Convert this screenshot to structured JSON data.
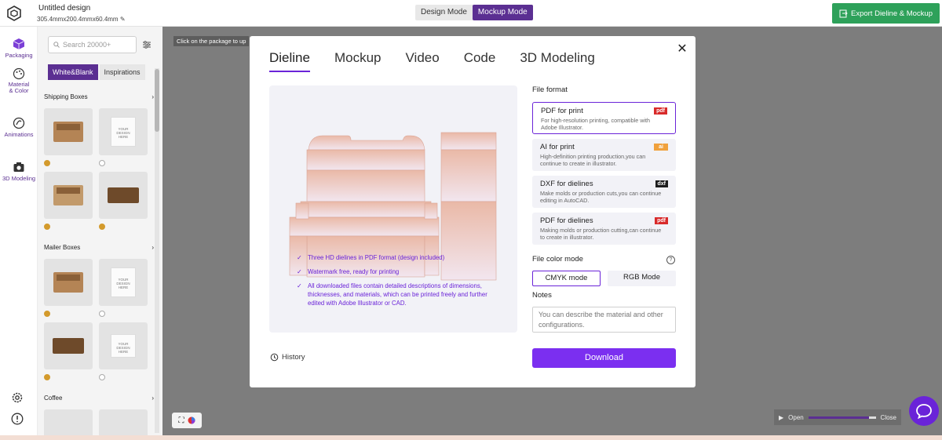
{
  "header": {
    "doc_title": "Untitled design",
    "doc_size": "305.4mmx200.4mmx60.4mm",
    "mode_design": "Design Mode",
    "mode_mockup": "Mockup Mode",
    "export_label": "Export Dieline & Mockup",
    "accent": "#5b2f92",
    "export_color": "#2ea15a"
  },
  "rail": {
    "packaging": "Packaging",
    "material_line1": "Material",
    "material_line2": "& Color",
    "animations": "Animations",
    "modeling": "3D Modeling"
  },
  "panel": {
    "search_placeholder": "Search 20000+",
    "tab_white": "White&Blank",
    "tab_inspirations": "Inspirations",
    "section_shipping": "Shipping Boxes",
    "section_mailer": "Mailer Boxes",
    "section_coffee": "Coffee",
    "thumb_text": "YOUR DESIGN HERE"
  },
  "canvas": {
    "hint": "Click on the package to up",
    "anim_open": "Open",
    "anim_close": "Close",
    "anim_progress": 0.9
  },
  "modal": {
    "tabs": [
      "Dieline",
      "Mockup",
      "Video",
      "Code",
      "3D Modeling"
    ],
    "features": [
      "Three HD dielines in PDF format (design included)",
      "Watermark free, ready for printing",
      "All downloaded files contain detailed descriptions of dimensions, thicknesses, and materials, which can be printed freely and further edited with Adobe Illustrator or CAD."
    ],
    "history": "History",
    "file_format_label": "File format",
    "formats": [
      {
        "name": "PDF for print",
        "desc": "For high-resolution printing, compatible with Adobe Illustrator.",
        "badge": "pdf"
      },
      {
        "name": "AI for print",
        "desc": "High-definition printing production,you can continue to create in illustrator.",
        "badge": "ai"
      },
      {
        "name": "DXF for dielines",
        "desc": "Make molds or production cuts,you can continue editing in AutoCAD.",
        "badge": "dxf"
      },
      {
        "name": "PDF for dielines",
        "desc": "Making molds or production cutting,can continue to create in illustrator.",
        "badge": "pdf"
      }
    ],
    "color_mode_label": "File color mode",
    "cmyk": "CMYK mode",
    "rgb": "RGB Mode",
    "notes_label": "Notes",
    "notes_placeholder": "You can describe the material and other configurations.",
    "download": "Download",
    "accent": "#6a23d8"
  }
}
